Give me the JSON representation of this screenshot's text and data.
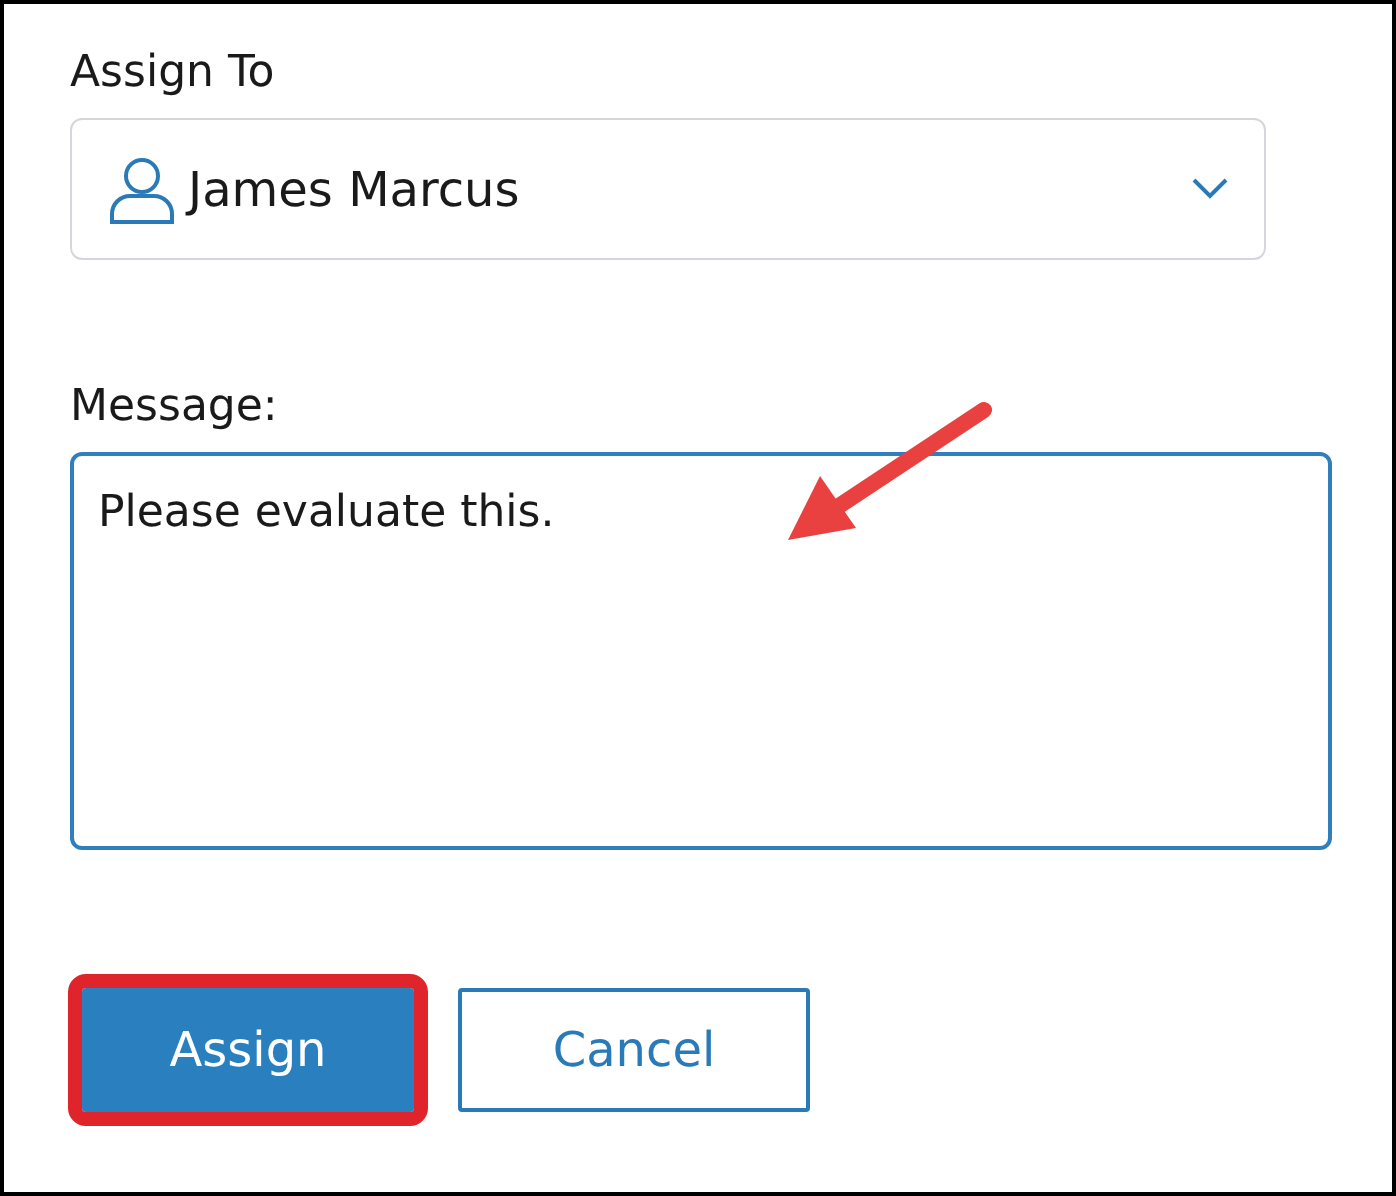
{
  "assign_to": {
    "label": "Assign To",
    "value": "James Marcus"
  },
  "message": {
    "label": "Message:",
    "value": "Please evaluate this."
  },
  "buttons": [
    {
      "label": "Assign",
      "kind": "primary",
      "highlighted": true
    },
    {
      "label": "Cancel",
      "kind": "secondary",
      "highlighted": false
    }
  ]
}
